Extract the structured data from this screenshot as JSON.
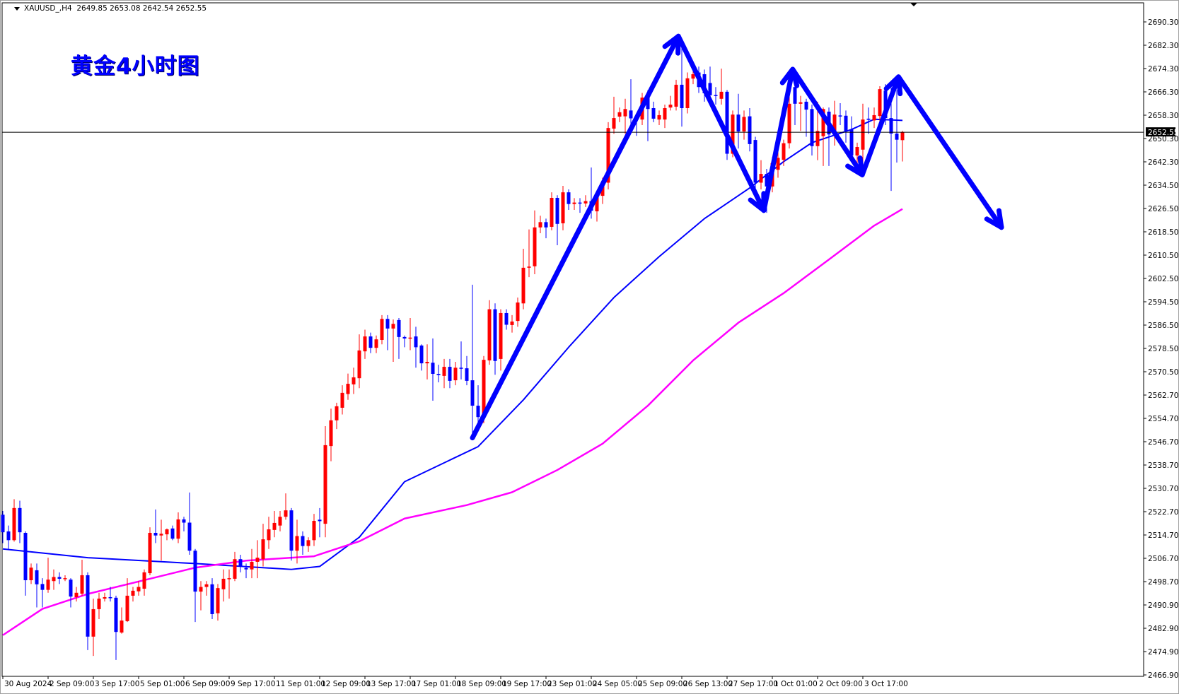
{
  "header": {
    "symbol": "XAUUSD_,H4",
    "ohlc_text": "2649.85 2653.08 2642.54 2652.55"
  },
  "annotation_title": "黄金4小时图",
  "colors": {
    "bull": "#ff0000",
    "bear": "#0000ff",
    "ma_fast": "#0000ff",
    "ma_slow": "#ff00ff",
    "arrow": "#0000ff"
  },
  "chart_data": {
    "type": "candlestick",
    "title": "XAUUSD_,H4",
    "current_price_label": "2652.55",
    "current_price": 2652.55,
    "ylim": [
      2466.9,
      2690.3
    ],
    "price_ticks": [
      "2690.30",
      "2682.30",
      "2674.30",
      "2666.30",
      "2658.30",
      "2650.30",
      "2642.30",
      "2634.50",
      "2626.50",
      "2618.50",
      "2610.50",
      "2602.50",
      "2594.50",
      "2586.50",
      "2578.50",
      "2570.50",
      "2562.70",
      "2554.70",
      "2546.70",
      "2538.70",
      "2530.70",
      "2522.70",
      "2514.70",
      "2506.70",
      "2498.70",
      "2490.90",
      "2482.90",
      "2474.90",
      "2466.90"
    ],
    "time_ticks": [
      "30 Aug 2024",
      "2 Sep 09:00",
      "3 Sep 17:00",
      "5 Sep 01:00",
      "6 Sep 09:00",
      "9 Sep 17:00",
      "11 Sep 01:00",
      "12 Sep 09:00",
      "13 Sep 17:00",
      "17 Sep 01:00",
      "18 Sep 09:00",
      "19 Sep 17:00",
      "23 Sep 01:00",
      "24 Sep 05:00",
      "25 Sep 09:00",
      "26 Sep 13:00",
      "27 Sep 17:00",
      "1 Oct 01:00",
      "2 Oct 09:00",
      "3 Oct 17:00"
    ],
    "bars_per_time_tick": 8,
    "ohlc": [
      [
        2521.7,
        2523,
        2512,
        2515.7
      ],
      [
        2516,
        2518,
        2510,
        2513
      ],
      [
        2513,
        2527,
        2512.5,
        2524
      ],
      [
        2524,
        2526.5,
        2512,
        2515.7
      ],
      [
        2515.5,
        2516,
        2494,
        2499.3
      ],
      [
        2499.3,
        2505,
        2498,
        2503.6
      ],
      [
        2502.7,
        2505,
        2490,
        2497.9
      ],
      [
        2498,
        2500,
        2490,
        2496
      ],
      [
        2496,
        2507,
        2495,
        2499.5
      ],
      [
        2499,
        2503,
        2496,
        2500.4
      ],
      [
        2500.4,
        2502,
        2498,
        2499.8
      ],
      [
        2499.8,
        2501,
        2499,
        2500
      ],
      [
        2499.5,
        2500,
        2490,
        2493.7
      ],
      [
        2493.5,
        2497,
        2492,
        2495
      ],
      [
        2494.7,
        2506.3,
        2494,
        2501
      ],
      [
        2501,
        2502,
        2475.4,
        2480
      ],
      [
        2480,
        2493,
        2473.4,
        2489.4
      ],
      [
        2489.4,
        2495,
        2486,
        2493
      ],
      [
        2493,
        2495,
        2492,
        2493.5
      ],
      [
        2493.5,
        2497,
        2492,
        2493.3
      ],
      [
        2493.3,
        2494,
        2472,
        2481.6
      ],
      [
        2481.4,
        2490,
        2481,
        2485.5
      ],
      [
        2485.3,
        2500,
        2485,
        2494
      ],
      [
        2494,
        2497,
        2492,
        2495.7
      ],
      [
        2495.5,
        2499,
        2494,
        2497
      ],
      [
        2496.4,
        2503,
        2494,
        2502
      ],
      [
        2501.7,
        2517.4,
        2501,
        2515.5
      ],
      [
        2515.5,
        2523.5,
        2512,
        2514.6
      ],
      [
        2514.6,
        2520,
        2506,
        2515.2
      ],
      [
        2515,
        2517,
        2513,
        2516.7
      ],
      [
        2517,
        2518,
        2513,
        2513.5
      ],
      [
        2513.5,
        2522.5,
        2512,
        2520.1
      ],
      [
        2520.1,
        2521,
        2516,
        2519
      ],
      [
        2519,
        2529.3,
        2508,
        2509.4
      ],
      [
        2509.4,
        2510,
        2485,
        2495.4
      ],
      [
        2495.4,
        2499,
        2489,
        2497
      ],
      [
        2497,
        2499,
        2494,
        2497.9
      ],
      [
        2497.9,
        2500,
        2486,
        2487.7
      ],
      [
        2488,
        2498,
        2485.5,
        2496.6
      ],
      [
        2496.2,
        2503,
        2492,
        2499.8
      ],
      [
        2499.8,
        2503,
        2493,
        2500
      ],
      [
        2499.8,
        2509,
        2499,
        2506.5
      ],
      [
        2506.5,
        2508,
        2502,
        2504
      ],
      [
        2503.5,
        2505,
        2500,
        2503
      ],
      [
        2503,
        2510,
        2500,
        2505.6
      ],
      [
        2505.6,
        2513,
        2500,
        2507
      ],
      [
        2506.5,
        2518.6,
        2504,
        2513.3
      ],
      [
        2513,
        2521,
        2510,
        2516.7
      ],
      [
        2516.5,
        2523,
        2514,
        2518.9
      ],
      [
        2518,
        2523,
        2516,
        2521
      ],
      [
        2521,
        2529,
        2520,
        2523.2
      ],
      [
        2523.2,
        2524,
        2506,
        2509.4
      ],
      [
        2509.4,
        2520,
        2505,
        2514.4
      ],
      [
        2514.4,
        2516,
        2508,
        2511
      ],
      [
        2511,
        2514,
        2509,
        2513
      ],
      [
        2513,
        2522,
        2511,
        2519.6
      ],
      [
        2520,
        2524,
        2514,
        2519.5
      ],
      [
        2518.6,
        2552,
        2514,
        2545.5
      ],
      [
        2545.2,
        2558,
        2540,
        2554
      ],
      [
        2554,
        2560,
        2551,
        2558.8
      ],
      [
        2558.3,
        2566,
        2556,
        2563.4
      ],
      [
        2563,
        2570,
        2561,
        2566.5
      ],
      [
        2566.3,
        2572,
        2563,
        2568.7
      ],
      [
        2568.4,
        2583.4,
        2565,
        2577.9
      ],
      [
        2577.6,
        2585,
        2575,
        2582.7
      ],
      [
        2582.7,
        2584,
        2577,
        2578.8
      ],
      [
        2578.8,
        2583,
        2577,
        2581.7
      ],
      [
        2581.5,
        2590,
        2580,
        2588.7
      ],
      [
        2588.7,
        2590,
        2578,
        2585.4
      ],
      [
        2585.4,
        2588.5,
        2574,
        2587
      ],
      [
        2588.3,
        2589,
        2575,
        2582.5
      ],
      [
        2582.5,
        2583,
        2579,
        2582
      ],
      [
        2582,
        2589,
        2578,
        2582.3
      ],
      [
        2582.7,
        2586,
        2572,
        2579
      ],
      [
        2579.6,
        2580,
        2571,
        2573.5
      ],
      [
        2573.5,
        2580,
        2568,
        2574
      ],
      [
        2573.7,
        2582,
        2560.7,
        2569.9
      ],
      [
        2569.9,
        2573,
        2567,
        2569.5
      ],
      [
        2569.2,
        2575,
        2565,
        2572.3
      ],
      [
        2572.3,
        2575,
        2565,
        2567.5
      ],
      [
        2567.7,
        2574,
        2566,
        2572
      ],
      [
        2572,
        2581,
        2568,
        2571.8
      ],
      [
        2571.8,
        2576,
        2566,
        2567.5
      ],
      [
        2567.7,
        2600.4,
        2547.2,
        2559
      ],
      [
        2559,
        2566,
        2552,
        2555.1
      ],
      [
        2555.1,
        2576,
        2553,
        2574.7
      ],
      [
        2574.5,
        2595.1,
        2573,
        2592
      ],
      [
        2592,
        2594,
        2569.6,
        2574.3
      ],
      [
        2575,
        2592,
        2571,
        2590.7
      ],
      [
        2590.7,
        2592,
        2585,
        2586.7
      ],
      [
        2586.6,
        2590,
        2584,
        2587.8
      ],
      [
        2588,
        2596,
        2586,
        2594.3
      ],
      [
        2594,
        2612.7,
        2592,
        2606.2
      ],
      [
        2606.2,
        2619.3,
        2603,
        2606.6
      ],
      [
        2606.7,
        2625.8,
        2604,
        2620
      ],
      [
        2620,
        2624,
        2618,
        2621.8
      ],
      [
        2621.8,
        2623,
        2616.3,
        2620
      ],
      [
        2620.2,
        2632,
        2619,
        2630.1
      ],
      [
        2630.1,
        2631,
        2613.9,
        2621.2
      ],
      [
        2621.4,
        2634.2,
        2619,
        2632
      ],
      [
        2632,
        2633,
        2626,
        2628
      ],
      [
        2628,
        2630,
        2626,
        2628.5
      ],
      [
        2628.5,
        2630,
        2625,
        2628.2
      ],
      [
        2628.2,
        2631,
        2627,
        2629
      ],
      [
        2629,
        2640.5,
        2623,
        2625.7
      ],
      [
        2625.5,
        2632,
        2622,
        2630.8
      ],
      [
        2630.8,
        2637,
        2628,
        2635.3
      ],
      [
        2635.3,
        2656,
        2633,
        2654
      ],
      [
        2653.8,
        2664.7,
        2652,
        2657.4
      ],
      [
        2657.9,
        2661,
        2656,
        2659.4
      ],
      [
        2658,
        2664,
        2652,
        2660.5
      ],
      [
        2660,
        2670.7,
        2654.4,
        2657.3
      ],
      [
        2657.8,
        2659,
        2651.3,
        2657.5
      ],
      [
        2656.9,
        2666,
        2655,
        2664.4
      ],
      [
        2664.4,
        2667,
        2649.5,
        2660.5
      ],
      [
        2660.8,
        2663,
        2656,
        2657.2
      ],
      [
        2656.9,
        2660,
        2655,
        2658.4
      ],
      [
        2656.9,
        2662,
        2654,
        2660.8
      ],
      [
        2661,
        2665,
        2660,
        2662
      ],
      [
        2661.3,
        2670.5,
        2660,
        2668.8
      ],
      [
        2668.8,
        2682.3,
        2654.5,
        2660.8
      ],
      [
        2660.8,
        2673,
        2659,
        2671
      ],
      [
        2670.9,
        2676,
        2669,
        2672.4
      ],
      [
        2673,
        2675,
        2666,
        2668
      ],
      [
        2672.4,
        2674,
        2663,
        2665.9
      ],
      [
        2669.4,
        2675,
        2663,
        2665.2
      ],
      [
        2665.3,
        2668,
        2662,
        2665
      ],
      [
        2664,
        2674.3,
        2662,
        2666.4
      ],
      [
        2666.4,
        2667,
        2643.1,
        2645.2
      ],
      [
        2645.2,
        2660,
        2644,
        2658.6
      ],
      [
        2658.6,
        2665.7,
        2647,
        2652.8
      ],
      [
        2652.8,
        2660,
        2650,
        2657.8
      ],
      [
        2658,
        2660.8,
        2646,
        2648.5
      ],
      [
        2649.9,
        2651,
        2633,
        2635.3
      ],
      [
        2635.3,
        2643,
        2633,
        2638.3
      ],
      [
        2638.3,
        2640,
        2625,
        2634
      ],
      [
        2634,
        2644,
        2632,
        2642
      ],
      [
        2639.7,
        2648,
        2637,
        2643.8
      ],
      [
        2643.1,
        2650,
        2641,
        2648.8
      ],
      [
        2648.8,
        2665,
        2647,
        2662.3
      ],
      [
        2668,
        2670,
        2655,
        2662.3
      ],
      [
        2662.3,
        2665,
        2653,
        2662.8
      ],
      [
        2663,
        2664,
        2651,
        2660.3
      ],
      [
        2660.5,
        2662,
        2644.6,
        2647.8
      ],
      [
        2647.8,
        2663,
        2643,
        2653
      ],
      [
        2651.2,
        2661,
        2641,
        2660.5
      ],
      [
        2659.6,
        2661,
        2641,
        2651.8
      ],
      [
        2653,
        2663.3,
        2648,
        2658.6
      ],
      [
        2658.3,
        2662.5,
        2655,
        2658
      ],
      [
        2658.2,
        2660,
        2649,
        2653
      ],
      [
        2653.5,
        2658,
        2643,
        2644.6
      ],
      [
        2644.6,
        2649,
        2639,
        2647.5
      ],
      [
        2646.6,
        2662.3,
        2640,
        2656.9
      ],
      [
        2657.2,
        2661,
        2652,
        2656.8
      ],
      [
        2656.6,
        2661,
        2654,
        2658.4
      ],
      [
        2658.1,
        2668.3,
        2656,
        2667.3
      ],
      [
        2666.8,
        2669,
        2655,
        2657.4
      ],
      [
        2657.4,
        2668,
        2632.5,
        2652.1
      ],
      [
        2652.1,
        2667,
        2642.2,
        2650
      ],
      [
        2649.85,
        2653.08,
        2642.54,
        2652.55
      ]
    ],
    "series": [
      {
        "name": "MA fast (blue)",
        "bars": [
          0,
          15,
          34,
          51,
          56,
          63,
          71,
          84,
          92,
          100,
          108,
          116,
          124,
          132,
          138,
          143,
          150,
          154,
          159
        ],
        "values": [
          2510,
          2507,
          2505,
          2503,
          2504,
          2514,
          2533,
          2545,
          2561,
          2579,
          2596,
          2610,
          2623,
          2633.5,
          2642.5,
          2649,
          2653.5,
          2657,
          2656.6
        ]
      },
      {
        "name": "MA slow (magenta)",
        "bars": [
          0,
          7,
          15,
          26,
          34,
          43,
          55,
          63,
          71,
          82,
          90,
          98,
          106,
          114,
          122,
          130,
          138,
          146,
          154,
          159
        ],
        "values": [
          2480.5,
          2489.5,
          2494.6,
          2499.8,
          2503.6,
          2506,
          2507.5,
          2512.6,
          2520.4,
          2525,
          2529.4,
          2537,
          2546,
          2559,
          2574.5,
          2587.4,
          2597.5,
          2609,
          2620.6,
          2626.3
        ]
      }
    ],
    "drawn_arrow_path": {
      "bars": [
        83,
        119.4,
        134.5,
        139.6,
        151.9,
        158.3,
        176.5
      ],
      "prices": [
        2548,
        2685.4,
        2625.8,
        2674.1,
        2638,
        2671.5,
        2620
      ]
    }
  }
}
